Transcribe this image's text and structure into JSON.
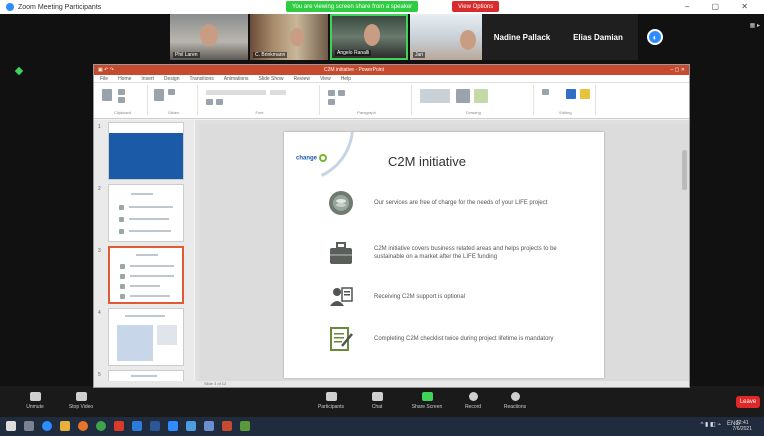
{
  "zoom": {
    "window_title": "Zoom Meeting Participants",
    "share_banner": "You are viewing screen share from a speaker",
    "stop_share": "View Options",
    "participants": [
      {
        "name": "Nadine Pallack"
      },
      {
        "name": "Elias Damian"
      }
    ],
    "tile_names": [
      "Phil Laren",
      "C. Brinkmann",
      "Angelo Ranalli",
      "Jari"
    ],
    "toolbar": {
      "unmute": "Unmute",
      "stop_video": "Stop Video",
      "participants": "Participants",
      "chat": "Chat",
      "share_screen": "Share Screen",
      "record": "Record",
      "reactions": "Reactions",
      "leave": "Leave"
    }
  },
  "ppt": {
    "window_title": "C2M initiative - PowerPoint",
    "menu": [
      "File",
      "Home",
      "Insert",
      "Design",
      "Transitions",
      "Animations",
      "Slide Show",
      "Review",
      "View",
      "Help"
    ],
    "ribbon_groups": [
      "Clipboard",
      "Slides",
      "Font",
      "Paragraph",
      "Drawing",
      "Editing"
    ],
    "slide": {
      "logo": "change",
      "title": "C2M initiative",
      "items": [
        {
          "icon": "coins-icon",
          "text": "Our services are free of charge for the needs of your LIFE project"
        },
        {
          "icon": "briefcase-icon",
          "text": "C2M initiative covers business related areas and helps projects to be sustainable on a market after the LIFE funding"
        },
        {
          "icon": "person-document-icon",
          "text": "Receiving C2M support is optional"
        },
        {
          "icon": "checklist-icon",
          "text": "Completing C2M checklist twice during project lifetime is mandatory"
        }
      ]
    },
    "thumbnails": [
      {
        "num": "1"
      },
      {
        "num": "2"
      },
      {
        "num": "3"
      },
      {
        "num": "4"
      },
      {
        "num": "5"
      }
    ],
    "status": "Slide 3 of 12"
  },
  "taskbar": {
    "time": "12:41",
    "date": "7/6/2021",
    "tray": "ENG"
  },
  "colors": {
    "ppt_accent": "#c64a2e",
    "zoom_blue": "#2d8cff",
    "share_green": "#2ecc40",
    "leave_red": "#e02828",
    "slide_blue": "#1b5aa6",
    "slide_green": "#76b82a"
  }
}
